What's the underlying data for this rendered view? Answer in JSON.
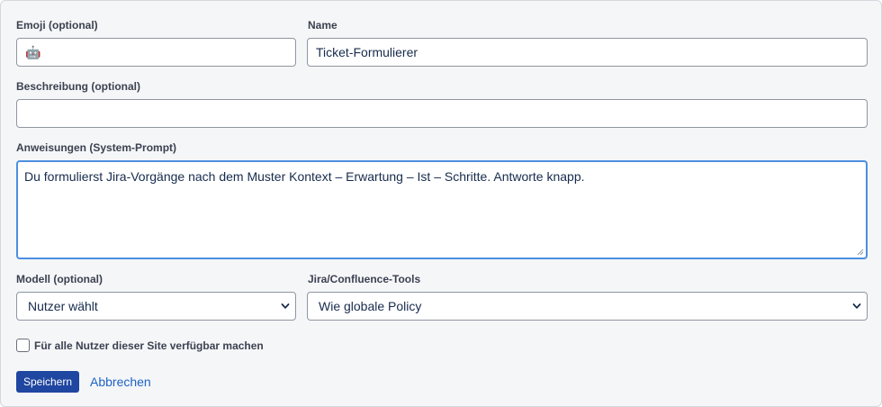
{
  "form": {
    "emoji": {
      "label": "Emoji (optional)",
      "value": "🤖",
      "icon": "robot-face-icon"
    },
    "name": {
      "label": "Name",
      "value": "Ticket-Formulierer"
    },
    "description": {
      "label": "Beschreibung (optional)",
      "value": ""
    },
    "instructions": {
      "label": "Anweisungen (System-Prompt)",
      "value": "Du formulierst Jira-Vorgänge nach dem Muster Kontext – Erwartung – Ist – Schritte. Antworte knapp."
    },
    "model": {
      "label": "Modell (optional)",
      "selected": "Nutzer wählt"
    },
    "tools": {
      "label": "Jira/Confluence-Tools",
      "selected": "Wie globale Policy"
    },
    "share": {
      "label": "Für alle Nutzer dieser Site verfügbar machen",
      "checked": false
    }
  },
  "actions": {
    "save_label": "Speichern",
    "cancel_label": "Abbrechen"
  },
  "colors": {
    "primary_button": "#1f46a0",
    "link": "#1d63c5",
    "focus_border": "#4c8fe0",
    "panel_background": "#f5f6f8"
  }
}
